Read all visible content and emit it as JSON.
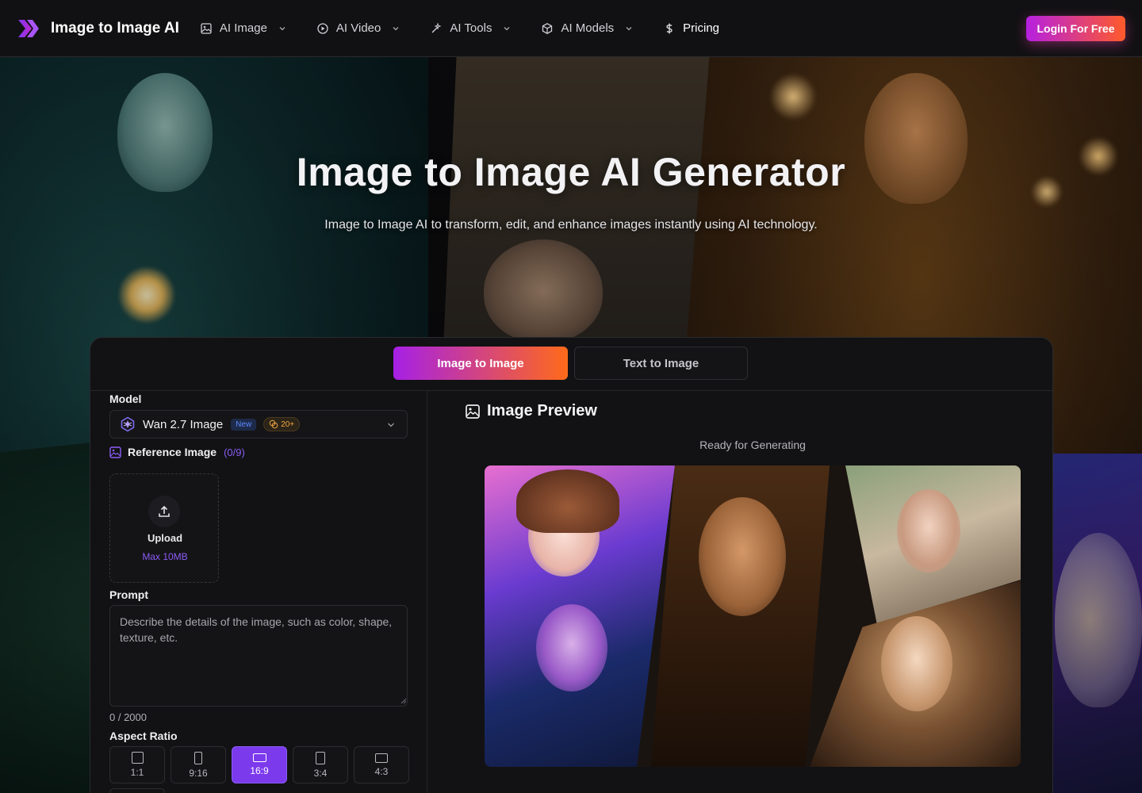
{
  "brand": {
    "name": "Image to Image AI"
  },
  "nav": {
    "items": [
      {
        "label": "AI Image",
        "icon": "image-icon"
      },
      {
        "label": "AI Video",
        "icon": "play-circle-icon"
      },
      {
        "label": "AI Tools",
        "icon": "magic-wand-icon"
      },
      {
        "label": "AI Models",
        "icon": "cube-icon"
      }
    ],
    "pricing": "Pricing",
    "login": "Login For Free"
  },
  "hero": {
    "title": "Image to Image AI Generator",
    "subtitle": "Image to Image AI to transform, edit, and enhance images instantly using AI technology."
  },
  "tabs": {
    "active": "Image to Image",
    "inactive": "Text to Image"
  },
  "form": {
    "model_label": "Model",
    "model_name": "Wan 2.7 Image",
    "model_badge": "New",
    "model_credits": "20+",
    "reference_label": "Reference Image",
    "reference_count": "(0/9)",
    "upload_label": "Upload",
    "upload_limit": "Max 10MB",
    "prompt_label": "Prompt",
    "prompt_placeholder": "Describe the details of the image, such as color, shape, texture, etc.",
    "char_count": "0 / 2000",
    "aspect_label": "Aspect Ratio",
    "ratios": [
      "1:1",
      "9:16",
      "16:9",
      "3:4",
      "4:3"
    ],
    "selected_ratio": "16:9"
  },
  "preview": {
    "title": "Image Preview",
    "status": "Ready for Generating"
  },
  "colors": {
    "accent_purple": "#7c3aed",
    "gradient_start": "#a620e6",
    "gradient_end": "#ff6a1a"
  }
}
